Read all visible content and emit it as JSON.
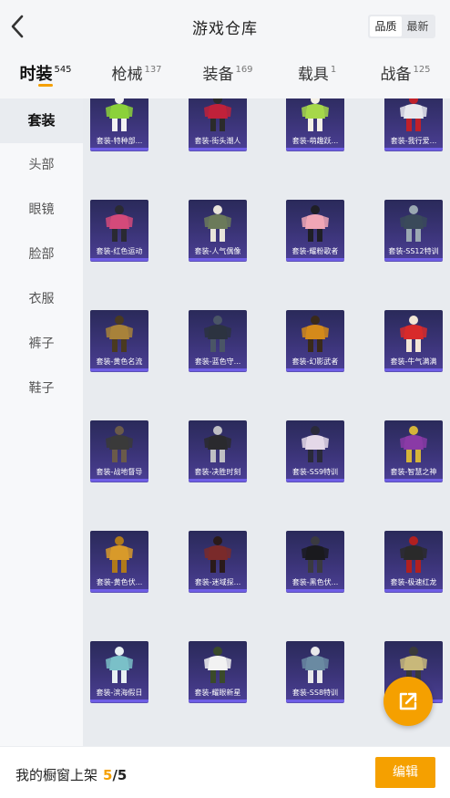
{
  "header": {
    "title": "游戏仓库",
    "back_icon": "chevron-left-icon",
    "sort_options": [
      "品质",
      "最新"
    ],
    "active_sort": 0
  },
  "tabs": [
    {
      "label": "时装",
      "count": "545"
    },
    {
      "label": "枪械",
      "count": "137"
    },
    {
      "label": "装备",
      "count": "169"
    },
    {
      "label": "载具",
      "count": "1"
    },
    {
      "label": "战备",
      "count": "125"
    }
  ],
  "active_tab": 0,
  "sidebar": {
    "items": [
      "套装",
      "头部",
      "眼镜",
      "脸部",
      "衣服",
      "裤子",
      "鞋子"
    ],
    "active": 0
  },
  "items": [
    {
      "name": "套装-特种部...",
      "palette": [
        "#8bd13a",
        "#f2f2f2"
      ]
    },
    {
      "name": "套装-街头潮人",
      "palette": [
        "#c0213a",
        "#2b2b2b"
      ]
    },
    {
      "name": "套装-萌趣跃...",
      "palette": [
        "#a6d84a",
        "#f4f0e6"
      ]
    },
    {
      "name": "套装-我行爱...",
      "palette": [
        "#e8e8ee",
        "#c0202a"
      ]
    },
    {
      "name": "套装-红色运动",
      "palette": [
        "#d44a7a",
        "#2a2a32"
      ]
    },
    {
      "name": "套装-人气偶像",
      "palette": [
        "#6b7a5a",
        "#e8e4da"
      ]
    },
    {
      "name": "套装-耀粉歌者",
      "palette": [
        "#f0a6b6",
        "#1f1f26"
      ]
    },
    {
      "name": "套装-SS12特训",
      "palette": [
        "#3a4a5a",
        "#9aa8b2"
      ]
    },
    {
      "name": "套装-黄色名流",
      "palette": [
        "#a8823a",
        "#4a3a20"
      ]
    },
    {
      "name": "套装-蓝色守...",
      "palette": [
        "#2c3340",
        "#4a5566"
      ]
    },
    {
      "name": "套装-幻影武者",
      "palette": [
        "#d48a1a",
        "#3a2a1a"
      ]
    },
    {
      "name": "套装-牛气满满",
      "palette": [
        "#d82a2a",
        "#f2e6d6"
      ]
    },
    {
      "name": "套装-战地督导",
      "palette": [
        "#3a3a3a",
        "#6a5a4a"
      ]
    },
    {
      "name": "套装-决胜时刻",
      "palette": [
        "#2a2a2e",
        "#bfbfc4"
      ]
    },
    {
      "name": "套装-SS9特训",
      "palette": [
        "#e4d8e8",
        "#2a2a3a"
      ]
    },
    {
      "name": "套装-智慧之神",
      "palette": [
        "#8a3aa6",
        "#d4b43a"
      ]
    },
    {
      "name": "套装-黄色伏...",
      "palette": [
        "#d89a2a",
        "#b07a1a"
      ]
    },
    {
      "name": "套装-迷域探...",
      "palette": [
        "#7a2a2a",
        "#2a1a1a"
      ]
    },
    {
      "name": "套装-黑色伏...",
      "palette": [
        "#1a1a1e",
        "#3a3a40"
      ]
    },
    {
      "name": "套装-极速红龙",
      "palette": [
        "#2a2a2a",
        "#b02020"
      ]
    },
    {
      "name": "套装-滨海假日",
      "palette": [
        "#7ac0c8",
        "#e8f0f2"
      ]
    },
    {
      "name": "套装-耀眼新星",
      "palette": [
        "#f2f2f2",
        "#3a4a2a"
      ]
    },
    {
      "name": "套装-SS8特训",
      "palette": [
        "#6a8aa2",
        "#e8e8ea"
      ]
    },
    {
      "name": "套装-...",
      "palette": [
        "#c8b87a",
        "#3a3a3a"
      ]
    }
  ],
  "footer": {
    "showcase_label": "我的橱窗上架",
    "showcase_current": "5",
    "showcase_total": "/5",
    "edit_label": "编辑"
  },
  "fab_icon": "share-icon",
  "colors": {
    "accent": "#f5a000",
    "card_top": "#2a2a5a",
    "card_bottom": "#4b3f95"
  }
}
